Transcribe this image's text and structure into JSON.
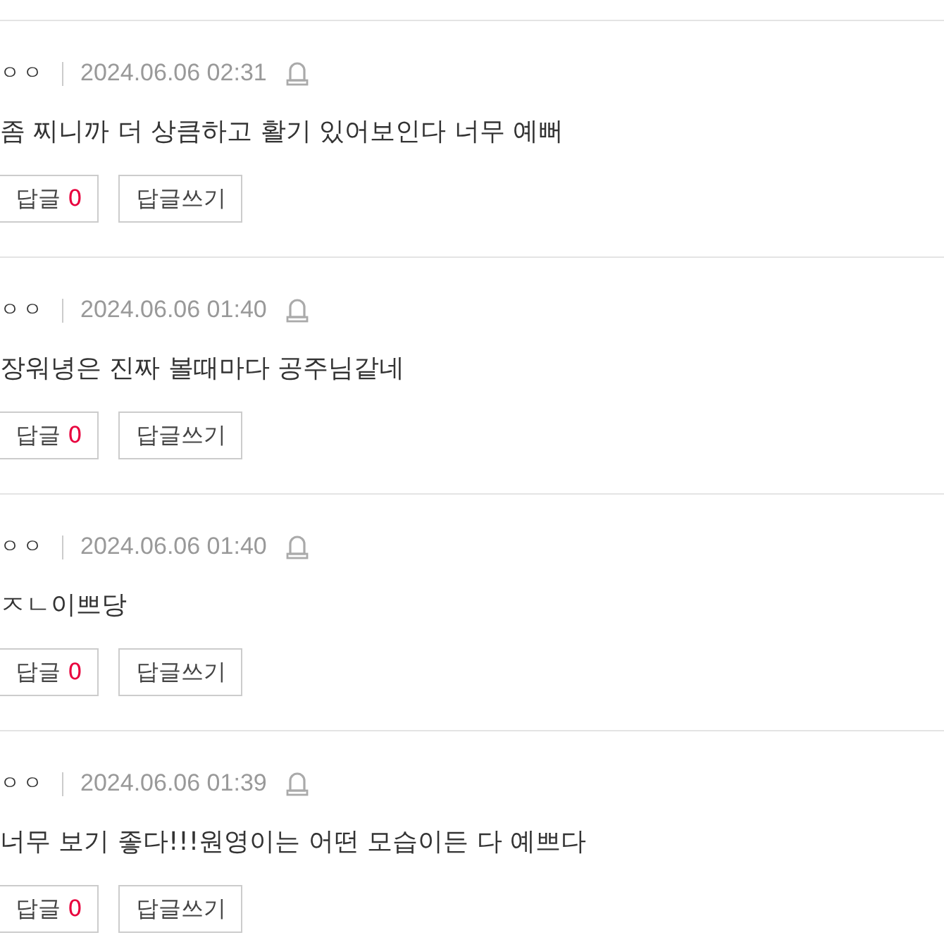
{
  "comments": [
    {
      "author": "ㅇㅇ",
      "date": "2024.06.06 02:31",
      "text": "좀 찌니까 더 상큼하고 활기 있어보인다 너무 예뻐",
      "reply_label": "답글",
      "reply_count": "0",
      "write_label": "답글쓰기"
    },
    {
      "author": "ㅇㅇ",
      "date": "2024.06.06 01:40",
      "text": "장워녕은 진짜 볼때마다 공주님같네",
      "reply_label": "답글",
      "reply_count": "0",
      "write_label": "답글쓰기"
    },
    {
      "author": "ㅇㅇ",
      "date": "2024.06.06 01:40",
      "text": "ㅈㄴ이쁘당",
      "reply_label": "답글",
      "reply_count": "0",
      "write_label": "답글쓰기"
    },
    {
      "author": "ㅇㅇ",
      "date": "2024.06.06 01:39",
      "text": "너무 보기 좋다!!!원영이는 어떤 모습이든 다 예쁘다",
      "reply_label": "답글",
      "reply_count": "0",
      "write_label": "답글쓰기"
    }
  ]
}
